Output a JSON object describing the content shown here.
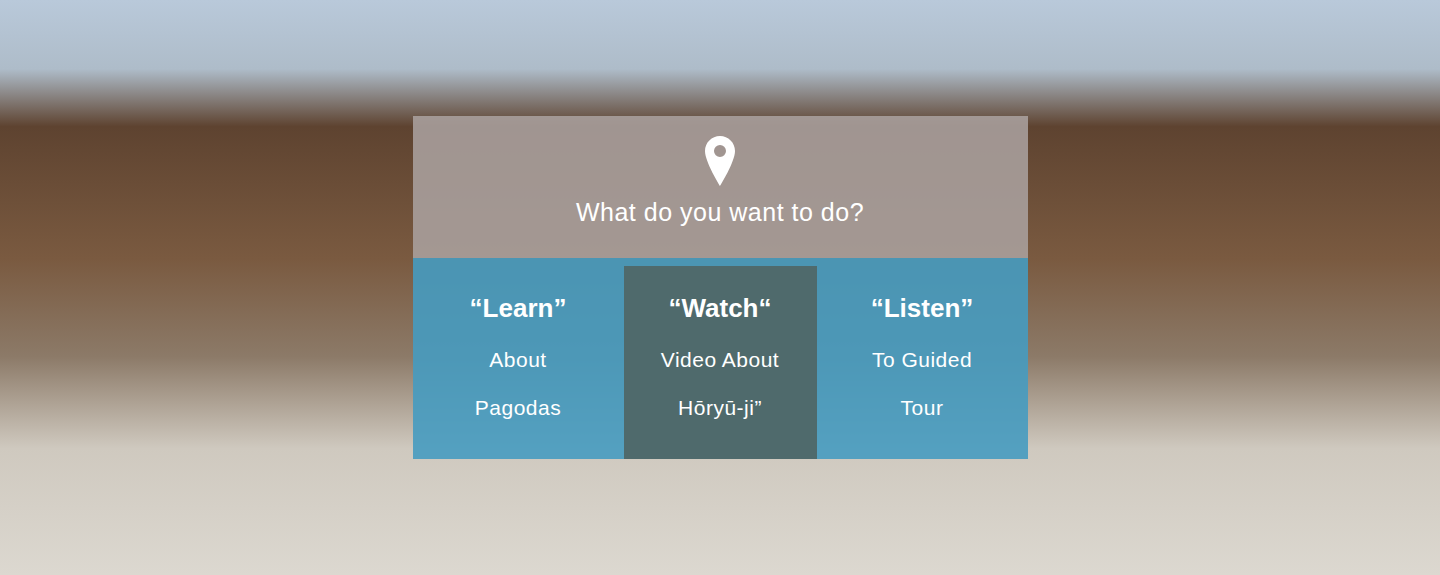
{
  "prompt": {
    "title": "What do you want to do?"
  },
  "options": [
    {
      "title": "“Learn”",
      "lines": [
        "About",
        "Pagodas"
      ],
      "selected": false
    },
    {
      "title": "“Watch“",
      "lines": [
        "Video About",
        "Hōryū-ji”"
      ],
      "selected": true
    },
    {
      "title": "“Listen”",
      "lines": [
        "To Guided",
        "Tour"
      ],
      "selected": false
    }
  ]
}
